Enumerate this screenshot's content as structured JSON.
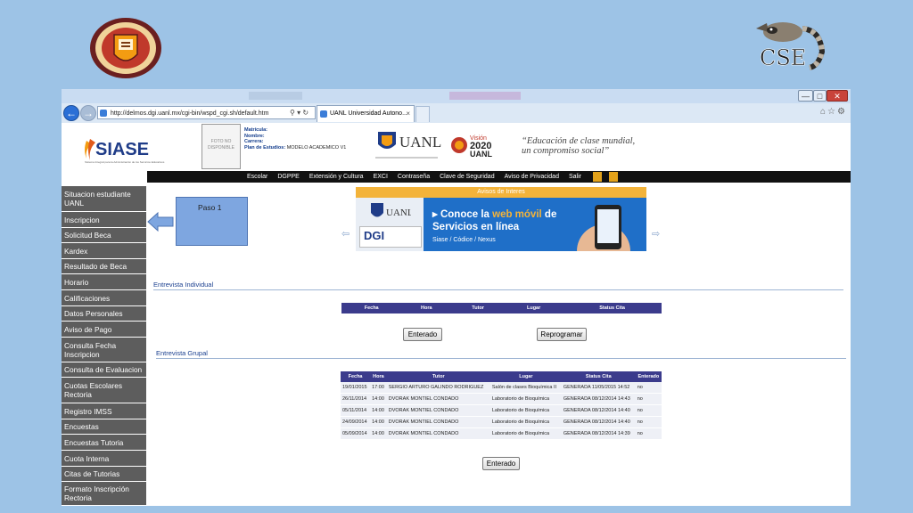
{
  "browser": {
    "url": "http://delmos.dgi.uanl.mx/cgi-bin/wspd_cgi.sh/default.htm",
    "url_tools": "⚲ ▾ ↻",
    "tab_title": "UANL Universidad Autono...",
    "tab_close": "×",
    "window_controls": {
      "minimize": "—",
      "maximize": "□",
      "close": "✕"
    },
    "toolbar_icons": "⌂☆⚙",
    "back": "←",
    "forward": "→"
  },
  "header": {
    "app_name": "SIASE",
    "app_tagline": "Sistema Integral para la Administración de los Servicios Educativos",
    "photo_placeholder": "FOTO NO DISPONIBLE",
    "student_labels": {
      "matricula": "Matrícula:",
      "nombre": "Nombre:",
      "carrera": "Carrera:",
      "plan": "Plan de Estudios:"
    },
    "plan_value": "MODELO ACADEMICO V1",
    "uanl_text": "UANL",
    "vision_label": "Visión",
    "vision_year": "2020",
    "vision_uanl": "UANL",
    "slogan_line1": "“Educación de clase mundial,",
    "slogan_line2": "un compromiso social”"
  },
  "top_nav": [
    "Escolar",
    "DGPPE",
    "Extensión y Cultura",
    "EXCI",
    "Contraseña",
    "Clave de Seguridad",
    "Aviso de Privacidad",
    "Salir"
  ],
  "sidebar": [
    "Situacion estudiante UANL",
    "Inscripcion",
    "Solicitud Beca",
    "Kardex",
    "Resultado de Beca",
    "Horario",
    "Calificaciones",
    "Datos Personales",
    "Aviso de Pago",
    "Consulta Fecha Inscripcion",
    "Consulta de Evaluacion",
    "Cuotas Escolares Rectoria",
    "Registro IMSS",
    "Encuestas",
    "Encuestas Tutoria",
    "Cuota Interna",
    "Citas de Tutorias",
    "Formato Inscripción Rectoria"
  ],
  "annotation": {
    "label": "Paso 1"
  },
  "banner": {
    "header": "Avisos de Interes",
    "uanl_text": "UANL",
    "dgi_text": "DGI",
    "title_line1_a": "Conoce la ",
    "title_line1_b": "web móvil",
    "title_line1_c": " de",
    "title_line2": "Servicios en línea",
    "subtitle": "Siase / Códice / Nexus",
    "prev": "⇦",
    "next": "⇨"
  },
  "individual": {
    "title": "Entrevista Individual",
    "headers": [
      "Fecha",
      "Hora",
      "Tutor",
      "Lugar",
      "Status Cita"
    ],
    "button_enterado": "Enterado",
    "button_reprogramar": "Reprogramar"
  },
  "grupal": {
    "title": "Entrevista Grupal",
    "headers": [
      "Fecha",
      "Hora",
      "Tutor",
      "Lugar",
      "Status Cita",
      "Enterado"
    ],
    "rows": [
      [
        "19/01/2015",
        "17:00",
        "SERGIO ARTURO GALINDO RODRIGUEZ",
        "Salón de clases Bioquímica II",
        "GENERADA 11/05/2015 14:52",
        "no"
      ],
      [
        "26/11/2014",
        "14:00",
        "DVORAK MONTIEL CONDADO",
        "Laboratorio de Bioquímica",
        "GENERADA 08/12/2014 14:43",
        "no"
      ],
      [
        "05/11/2014",
        "14:00",
        "DVORAK MONTIEL CONDADO",
        "Laboratorio de Bioquímica",
        "GENERADA 08/12/2014 14:40",
        "no"
      ],
      [
        "24/09/2014",
        "14:00",
        "DVORAK MONTIEL CONDADO",
        "Laboratorio de Bioquímica",
        "GENERADA 08/12/2014 14:40",
        "no"
      ],
      [
        "05/09/2014",
        "14:00",
        "DVORAK MONTIEL CONDADO",
        "Laboratorio de Bioquímica",
        "GENERADA 08/12/2014 14:39",
        "no"
      ]
    ],
    "button_enterado": "Enterado"
  },
  "slide": {
    "cse_text": "CSE"
  },
  "colors": {
    "slide_bg": "#9dc3e6",
    "sidebar_bg": "#5d5d5d",
    "nav_bg": "#111111",
    "table_header": "#3b3b8c",
    "banner_accent": "#f3b33a",
    "annotation_fill": "#7ea6e0"
  }
}
